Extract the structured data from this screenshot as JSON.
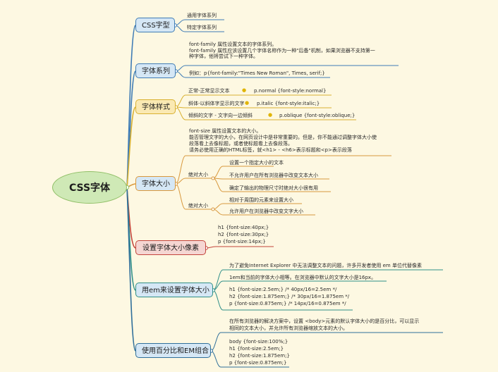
{
  "root": "CSS字体",
  "topics": {
    "t1": "CSS字型",
    "t2": "字体系列",
    "t3": "字体样式",
    "t4": "字体大小",
    "t5": "设置字体大小像素",
    "t6": "用em来设置字体大小",
    "t7": "使用百分比和EM组合"
  },
  "b1": {
    "generic": "通用字体系列",
    "specific": "特定字体系列"
  },
  "b2": {
    "desc": [
      "font-family 属性设置文本的字体系列。",
      "font-family 属性应该设置几个字体名称作为一种\"后备\"机制，如果浏览器不支持第一",
      "种字体，他将尝试下一种字体。"
    ],
    "example": "例如：p{font-family:\"Times New Roman\", Times, serif;}"
  },
  "b3": {
    "normal": "正常-正常显示文本",
    "normal_code": "p.normal {font-style:normal}",
    "italic": "斜体-以斜体字显示的文字",
    "italic_code": "p.italic {font-style:italic;}",
    "oblique": "倾斜的文字 - 文字向一边倾斜",
    "oblique_code": "p.oblique {font-style:oblique;}",
    "bullet": "●"
  },
  "b4": {
    "desc": [
      "font-size 属性设置文本的大小。",
      "能否管理文字的大小，在网页设计中是非常重要的。但是，你不能通过调整字体大小使",
      "段落看上去像标题，或者使标题看上去像段落。",
      "请务必使用正确的HTML标签，就<h1> - <h6>表示标题和<p>表示段落"
    ],
    "abs_label": "绝对大小",
    "abs": [
      "设置一个指定大小的文本",
      "不允许用户在所有浏览器中改变文本大小",
      "确定了输出的物理尺寸时绝对大小很有用"
    ],
    "rel_label": "绝对大小",
    "rel": [
      "相对于周围的元素来设置大小",
      "允许用户在浏览器中改变文字大小"
    ]
  },
  "b5": {
    "lines": [
      "h1 {font-size:40px;}",
      "h2 {font-size:30px;}",
      "p {font-size:14px;}"
    ]
  },
  "b6": {
    "desc1": "为了避免Internet Explorer 中无法调整文本的问题，许多开发者使用 em 单位代替像素",
    "desc2": "1em和当前的字体大小相等。在浏览器中默认的文字大小是16px。",
    "code": [
      "h1 {font-size:2.5em;} /* 40px/16=2.5em */",
      "h2 {font-size:1.875em;} /* 30px/16=1.875em */",
      "p {font-size:0.875em;} /* 14px/16=0.875em */"
    ]
  },
  "b7": {
    "desc": [
      "在所有浏览器的解决方案中，设置 <body>元素的默认字体大小的是百分比，可以显示",
      "相同的文本大小，并允许所有浏览器缩放文本的大小。"
    ],
    "code": [
      "body {font-size:100%;}",
      "h1 {font-size:2.5em;}",
      "h2 {font-size:1.875em;}",
      "p {font-size:0.875em;}"
    ]
  }
}
